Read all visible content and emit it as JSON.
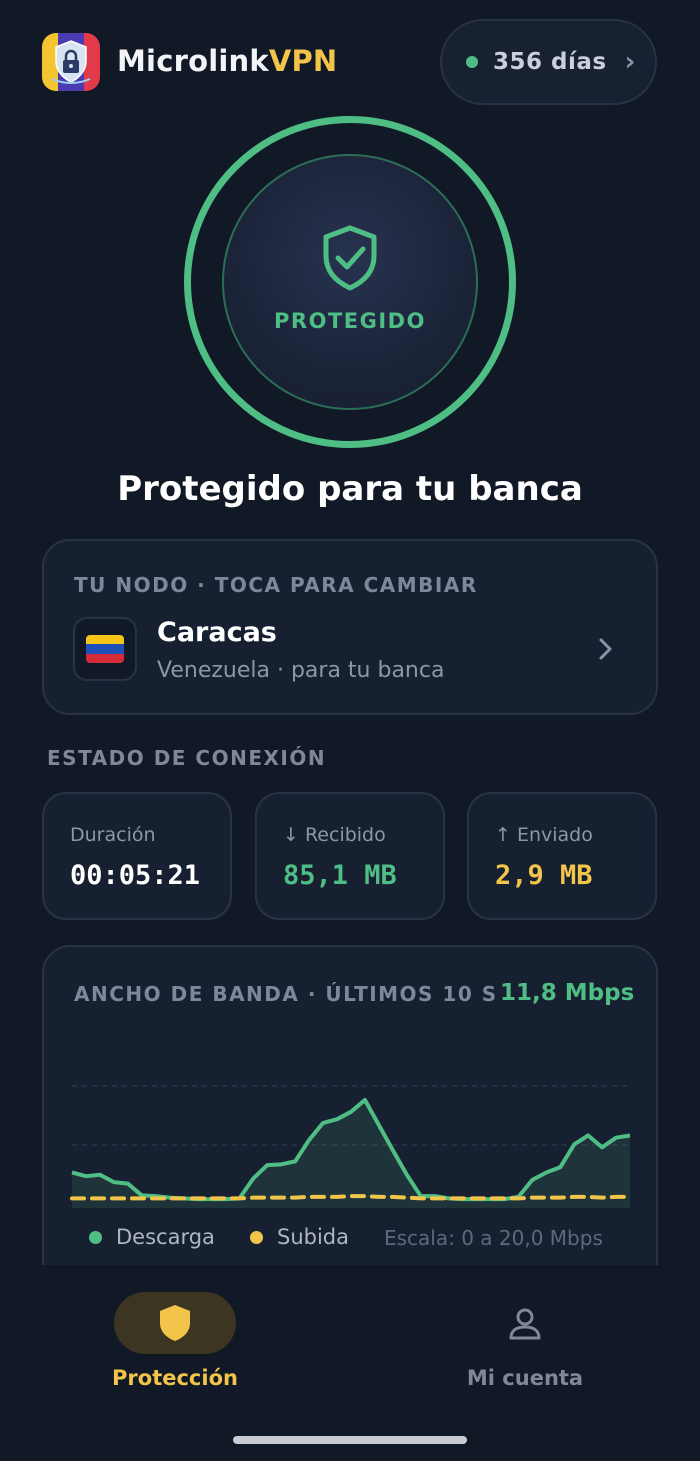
{
  "header": {
    "brand_primary": "Microlink",
    "brand_accent": "VPN",
    "days_label": "356 días",
    "logo_icon": "padlock-shield-icon"
  },
  "connection_button": {
    "status_label": "PROTEGIDO",
    "icon": "shield-check-icon",
    "color": "#4fbe84"
  },
  "headline": "Protegido para tu banca",
  "node": {
    "caption": "TU NODO · TOCA PARA CAMBIAR",
    "city": "Caracas",
    "subtitle": "Venezuela · para tu banca",
    "flag": "venezuela-flag"
  },
  "connection_status": {
    "title": "ESTADO DE CONEXIÓN",
    "stats": [
      {
        "label": "Duración",
        "value": "00:05:21",
        "color": "#ffffff"
      },
      {
        "label": "↓ Recibido",
        "value": "85,1 MB",
        "color": "#4fbe84"
      },
      {
        "label": "↑ Enviado",
        "value": "2,9 MB",
        "color": "#f2c54a"
      }
    ]
  },
  "bandwidth": {
    "caption": "ANCHO DE BANDA · ÚLTIMOS 10 S",
    "current_rate": "11,8 Mbps",
    "legend_download": "Descarga",
    "legend_upload": "Subida",
    "scale": "Escala: 0 a 20,0 Mbps"
  },
  "chart_data": {
    "type": "area",
    "y_range_mbps": [
      0,
      20
    ],
    "series": [
      {
        "name": "Descarga",
        "color": "#4fbe84",
        "values": [
          4.8,
          4.3,
          4.5,
          3.5,
          3.3,
          1.7,
          1.6,
          1.4,
          1.3,
          1.2,
          1.2,
          1.2,
          1.3,
          4.0,
          5.8,
          5.9,
          6.3,
          9.2,
          11.5,
          12.0,
          13.0,
          14.6,
          11.2,
          7.8,
          4.5,
          1.6,
          1.6,
          1.3,
          1.2,
          1.2,
          1.2,
          1.2,
          1.5,
          3.8,
          4.8,
          5.5,
          8.6,
          9.8,
          8.2,
          9.5,
          9.8
        ]
      },
      {
        "name": "Subida",
        "color": "#f2c54a",
        "values": [
          1.3,
          1.3,
          1.3,
          1.3,
          1.3,
          1.3,
          1.3,
          1.3,
          1.3,
          1.3,
          1.3,
          1.3,
          1.3,
          1.4,
          1.4,
          1.4,
          1.4,
          1.5,
          1.5,
          1.5,
          1.6,
          1.6,
          1.5,
          1.5,
          1.4,
          1.3,
          1.3,
          1.3,
          1.3,
          1.3,
          1.3,
          1.3,
          1.3,
          1.4,
          1.4,
          1.4,
          1.5,
          1.5,
          1.4,
          1.5,
          1.5
        ]
      }
    ]
  },
  "nav": {
    "items": [
      {
        "label": "Protección",
        "icon": "shield-icon",
        "active": true
      },
      {
        "label": "Mi cuenta",
        "icon": "user-icon",
        "active": false
      }
    ]
  },
  "colors": {
    "background": "#111826",
    "card": "#172030",
    "accent_green": "#4fbe84",
    "accent_yellow": "#f2c54a"
  }
}
